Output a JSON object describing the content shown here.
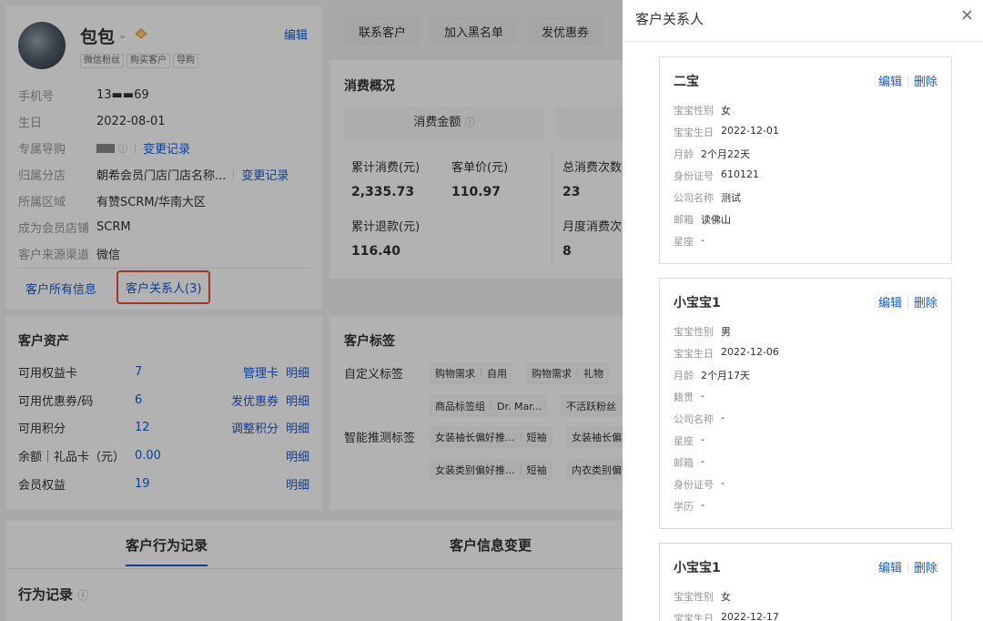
{
  "profile": {
    "name": "包包",
    "edit": "编辑",
    "tags": [
      "微信粉丝",
      "购买客户",
      "导购"
    ],
    "fields": [
      {
        "key": "手机号",
        "value": "13▬▬69"
      },
      {
        "key": "生日",
        "value": "2022-08-01"
      },
      {
        "key": "专属导购",
        "value": "",
        "link": "变更记录"
      },
      {
        "key": "归属分店",
        "value": "朝希会员门店门店名称...",
        "link": "变更记录"
      },
      {
        "key": "所属区域",
        "value": "有赞SCRM/华南大区"
      },
      {
        "key": "成为会员店铺",
        "value": "SCRM"
      },
      {
        "key": "客户来源渠道",
        "value": "微信"
      }
    ],
    "tab_all_info": "客户所有信息",
    "tab_contacts": "客户关系人(3)"
  },
  "assets": {
    "title": "客户资产",
    "rows": [
      {
        "label": "可用权益卡",
        "value": "7",
        "action": "管理卡",
        "detail": "明细"
      },
      {
        "label": "可用优惠券/码",
        "value": "6",
        "action": "发优惠券",
        "detail": "明细"
      },
      {
        "label": "可用积分",
        "value": "12",
        "action": "调整积分",
        "detail": "明细"
      },
      {
        "label": "余额｜礼品卡（元）",
        "value": "0.00",
        "action": "",
        "detail": "明细"
      },
      {
        "label": "会员权益",
        "value": "19",
        "action": "",
        "detail": "明细"
      }
    ]
  },
  "toolbar": {
    "buttons": [
      "联系客户",
      "加入黑名单",
      "发优惠券"
    ]
  },
  "consumption": {
    "title": "消费概况",
    "header": "消费金额",
    "labels": [
      "累计消费(元)",
      "客单价(元)",
      "总消费次数",
      "累计退款(元)",
      "月度消费次"
    ],
    "values": [
      "2,335.73",
      "110.97",
      "23",
      "116.40",
      "8"
    ]
  },
  "customer_tags": {
    "title": "客户标签",
    "custom_label": "自定义标签",
    "smart_label": "智能推测标签",
    "custom_chips": [
      [
        "购物需求",
        "自用"
      ],
      [
        "购物需求",
        "礼物"
      ],
      [
        "商品标签组",
        "Dr. Mar..."
      ],
      [
        "不活跃粉丝"
      ]
    ],
    "smart_chips": [
      [
        "女装袖长偏好推...",
        "短袖"
      ],
      [
        "女装袖长偏"
      ],
      [
        "女装类别偏好推...",
        "短袖"
      ],
      [
        "内衣类别偏"
      ]
    ]
  },
  "behavior": {
    "tab_active": "客户行为记录",
    "tab_other": "客户信息变更",
    "section": "行为记录"
  },
  "drawer": {
    "title": "客户关系人",
    "close": "×",
    "edit": "编辑",
    "delete": "删除",
    "contacts": [
      {
        "name": "二宝",
        "fields": [
          {
            "k": "宝宝性别",
            "v": "女"
          },
          {
            "k": "宝宝生日",
            "v": "2022-12-01"
          },
          {
            "k": "月龄",
            "v": "2个月22天"
          },
          {
            "k": "身份证号",
            "v": "610121"
          },
          {
            "k": "公司名称",
            "v": "测试"
          },
          {
            "k": "邮箱",
            "v": "读佛山"
          },
          {
            "k": "星座",
            "v": "-"
          }
        ]
      },
      {
        "name": "小宝宝1",
        "fields": [
          {
            "k": "宝宝性别",
            "v": "男"
          },
          {
            "k": "宝宝生日",
            "v": "2022-12-06"
          },
          {
            "k": "月龄",
            "v": "2个月17天"
          },
          {
            "k": "籍贯",
            "v": "-"
          },
          {
            "k": "公司名称",
            "v": "-"
          },
          {
            "k": "星座",
            "v": "-"
          },
          {
            "k": "邮箱",
            "v": "-"
          },
          {
            "k": "身份证号",
            "v": "-"
          },
          {
            "k": "学历",
            "v": "-"
          }
        ]
      },
      {
        "name": "小宝宝1",
        "fields": [
          {
            "k": "宝宝性别",
            "v": "女"
          },
          {
            "k": "宝宝生日",
            "v": "2022-12-17"
          }
        ]
      }
    ]
  },
  "colors": {
    "accent": "#155bd4",
    "highlight": "#e64c3a",
    "overlay": "rgba(0,0,0,0.3)"
  }
}
